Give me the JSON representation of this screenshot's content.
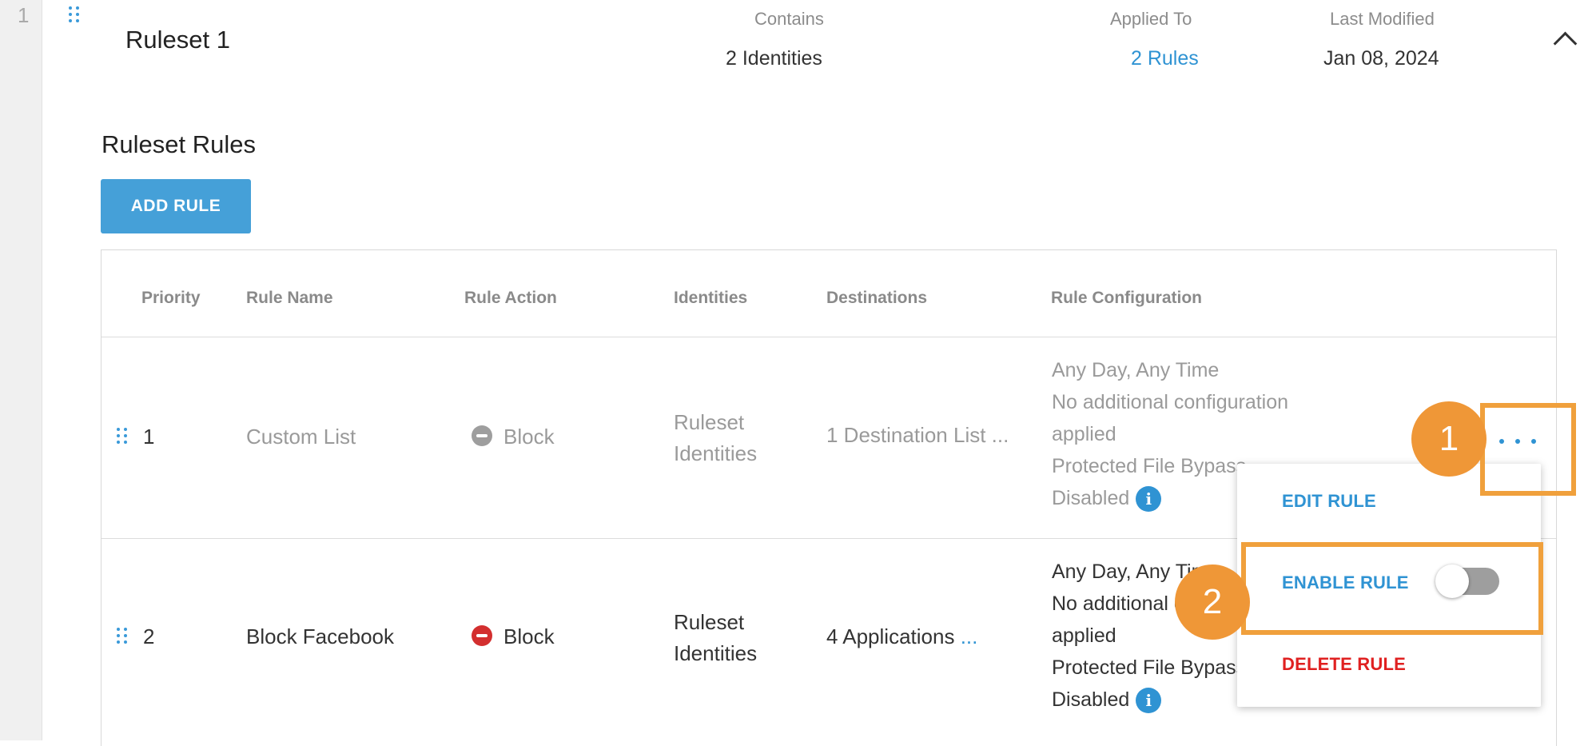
{
  "row_index": "1",
  "ruleset": {
    "title": "Ruleset 1",
    "contains_label": "Contains",
    "contains_value": "2 Identities",
    "applied_to_label": "Applied To",
    "applied_to_value": "2 Rules",
    "last_modified_label": "Last Modified",
    "last_modified_value": "Jan 08, 2024"
  },
  "section": {
    "title": "Ruleset Rules",
    "add_rule_label": "ADD RULE"
  },
  "table": {
    "headers": [
      "Priority",
      "Rule Name",
      "Rule Action",
      "Identities",
      "Destinations",
      "Rule Configuration"
    ],
    "rows": [
      {
        "priority": "1",
        "name": "Custom List",
        "action": "Block",
        "identities_line1": "Ruleset",
        "identities_line2": "Identities",
        "destinations": "1 Destination List ...",
        "config_line1": "Any Day, Any Time",
        "config_line2": "No additional configuration",
        "config_line3": "applied",
        "config_line4": "Protected File Bypass",
        "config_line5": "Disabled",
        "enabled": false
      },
      {
        "priority": "2",
        "name": "Block Facebook",
        "action": "Block",
        "identities_line1": "Ruleset",
        "identities_line2": "Identities",
        "destinations": "4 Applications",
        "destinations_more": "...",
        "config_line1": "Any Day, Any Time",
        "config_line2": "No additional configuration",
        "config_line3": "applied",
        "config_line4": "Protected File Bypass",
        "config_line5": "Disabled",
        "enabled": true
      }
    ]
  },
  "menu": {
    "edit_label": "EDIT RULE",
    "enable_label": "ENABLE RULE",
    "enable_toggle_on": false,
    "delete_label": "DELETE RULE"
  },
  "callouts": [
    "1",
    "2"
  ],
  "colors": {
    "accent": "#2f93d3",
    "button": "#45a0d8",
    "callout": "#ef9737",
    "block_active": "#d32f2f",
    "block_disabled": "#9e9e9e",
    "delete": "#e02020"
  },
  "icons": {
    "drag": "drag-handle-icon",
    "more": "more-options-icon",
    "info": "info-icon",
    "collapse": "chevron-up-icon",
    "block": "block-icon"
  }
}
